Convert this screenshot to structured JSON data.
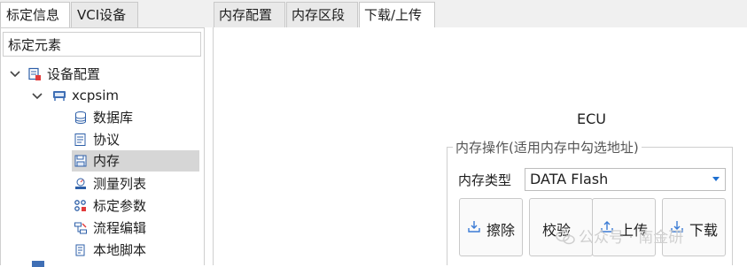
{
  "left_tabs": [
    {
      "label": "标定信息",
      "active": true
    },
    {
      "label": "VCI设备",
      "active": false
    }
  ],
  "left_panel": {
    "header": "标定元素",
    "tree": [
      {
        "label": "设备配置",
        "icon": "device-config-icon",
        "expanded": true
      },
      {
        "label": "xcpsim",
        "icon": "ecu-icon",
        "expanded": true
      },
      {
        "label": "数据库",
        "icon": "database-icon"
      },
      {
        "label": "协议",
        "icon": "protocol-icon"
      },
      {
        "label": "内存",
        "icon": "memory-icon",
        "selected": true
      },
      {
        "label": "测量列表",
        "icon": "measurement-list-icon"
      },
      {
        "label": "标定参数",
        "icon": "calibration-params-icon"
      },
      {
        "label": "流程编辑",
        "icon": "flow-edit-icon"
      },
      {
        "label": "本地脚本",
        "icon": "local-script-icon"
      }
    ]
  },
  "right_tabs": [
    {
      "label": "内存配置",
      "active": false
    },
    {
      "label": "内存区段",
      "active": false
    },
    {
      "label": "下载/上传",
      "active": true
    }
  ],
  "main": {
    "ecu_title": "ECU",
    "group_title": "内存操作(适用内存中勾选地址)",
    "memory_type_label": "内存类型",
    "memory_type_value": "DATA Flash",
    "buttons": [
      {
        "label": "擦除",
        "icon": "erase-icon"
      },
      {
        "label": "校验",
        "icon": ""
      },
      {
        "label": "上传",
        "icon": "upload-icon"
      },
      {
        "label": "下载",
        "icon": "download-icon"
      }
    ]
  },
  "watermark": "公众号 · 南金研",
  "colors": {
    "selection": "#d6d6d6",
    "accent": "#1e6fd0",
    "tab_bg": "#e9e9e9"
  }
}
